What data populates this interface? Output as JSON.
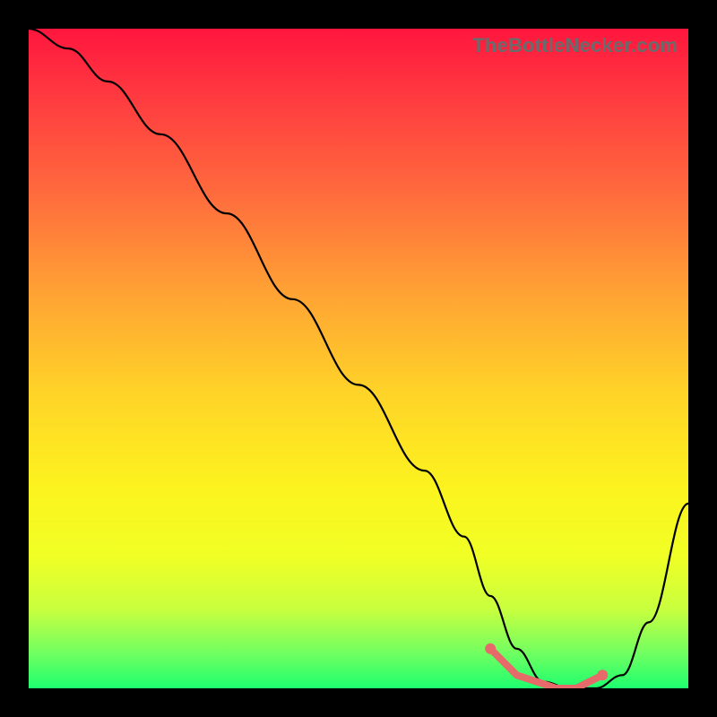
{
  "watermark": "TheBottleNecker.com",
  "colors": {
    "page_bg": "#000000",
    "curve": "#000000",
    "marker_stroke": "#e76a6a",
    "marker_fill": "#e76a6a"
  },
  "chart_data": {
    "type": "line",
    "title": "",
    "xlabel": "",
    "ylabel": "",
    "xlim": [
      0,
      100
    ],
    "ylim": [
      0,
      100
    ],
    "series": [
      {
        "name": "bottleneck-curve",
        "x": [
          0,
          6,
          12,
          20,
          30,
          40,
          50,
          60,
          66,
          70,
          74,
          78,
          82,
          86,
          90,
          94,
          100
        ],
        "y": [
          100,
          97,
          92,
          84,
          72,
          59,
          46,
          33,
          23,
          14,
          6,
          1,
          0,
          0,
          2,
          10,
          28
        ]
      }
    ],
    "highlight": {
      "name": "optimal-range-markers",
      "x": [
        70,
        72,
        74,
        77,
        80,
        83,
        85,
        87
      ],
      "y": [
        6,
        4,
        2,
        1,
        0,
        0,
        1,
        2
      ]
    }
  }
}
